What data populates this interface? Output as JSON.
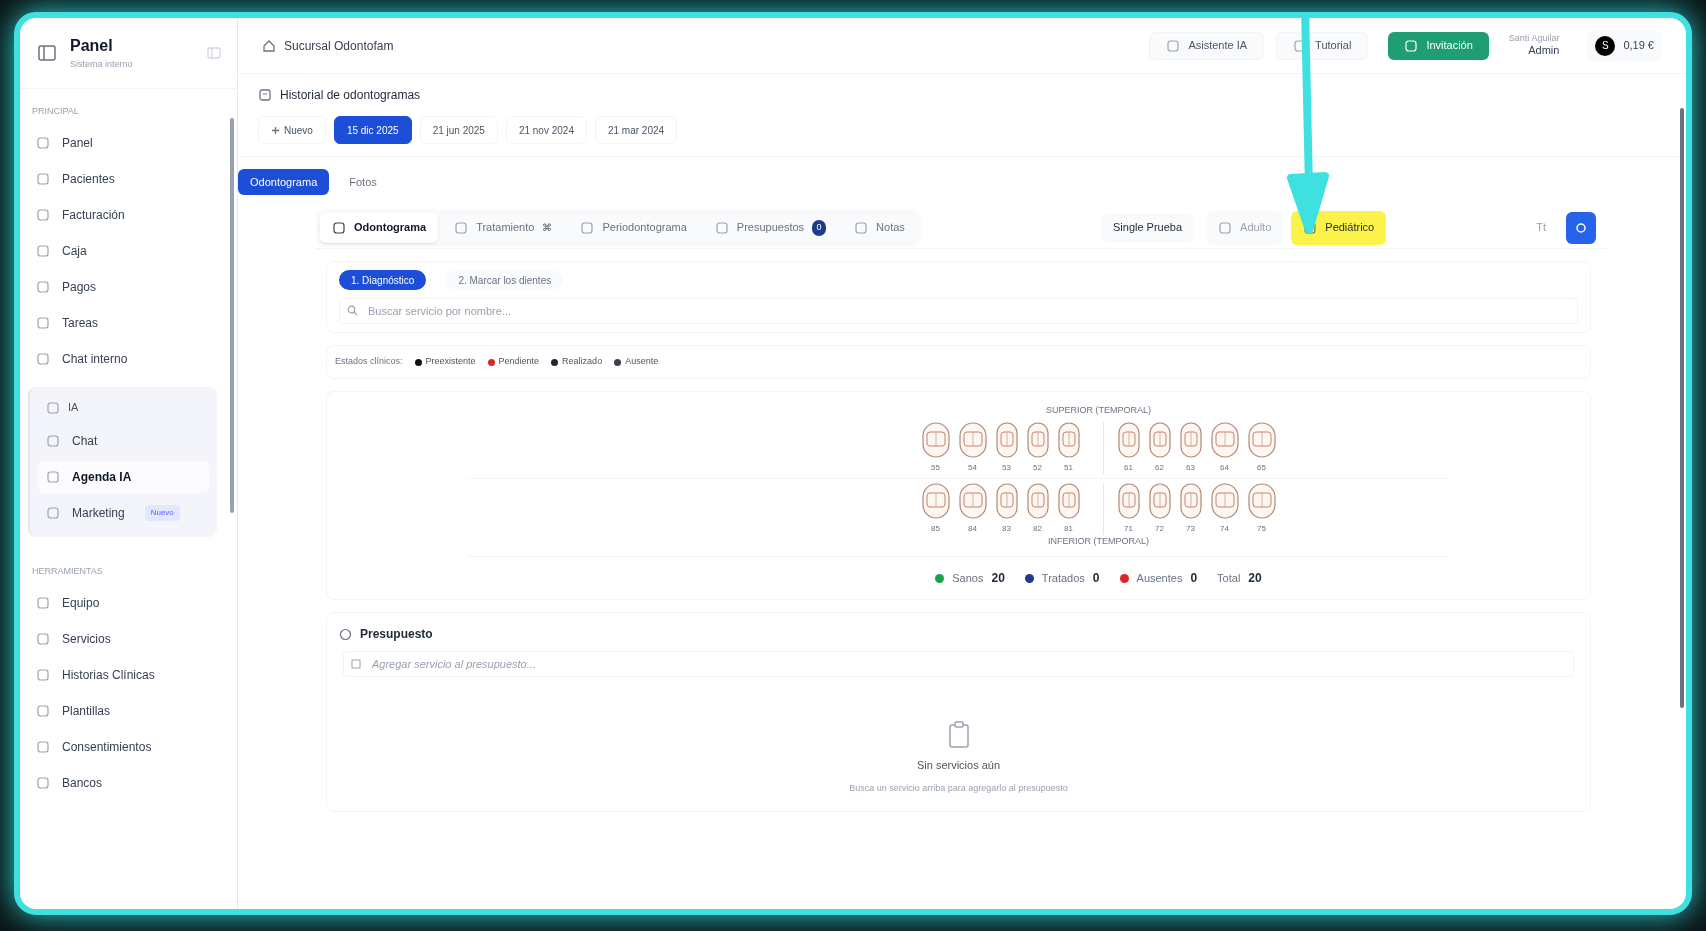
{
  "sidebar": {
    "title": "Panel",
    "subtitle": "Sistema interno",
    "sections": [
      {
        "kind": "plain",
        "label": "PRINCIPAL",
        "items": [
          {
            "label": "Panel",
            "selected": false
          },
          {
            "label": "Pacientes",
            "selected": false
          },
          {
            "label": "Facturación",
            "selected": false
          },
          {
            "label": "Caja",
            "selected": false
          },
          {
            "label": "Pagos",
            "selected": false
          },
          {
            "label": "Tareas",
            "selected": false
          },
          {
            "label": "Chat interno",
            "selected": false
          }
        ]
      },
      {
        "kind": "group",
        "label": "IA",
        "items": [
          {
            "label": "Chat",
            "selected": false
          },
          {
            "label": "Agenda IA",
            "selected": true
          },
          {
            "label": "Marketing",
            "selected": false,
            "badge": "Nuevo"
          }
        ]
      },
      {
        "kind": "plain",
        "label": "HERRAMIENTAS",
        "items": [
          {
            "label": "Equipo",
            "selected": false
          },
          {
            "label": "Servicios",
            "selected": false
          },
          {
            "label": "Historias Clínicas",
            "selected": false
          },
          {
            "label": "Plantillas",
            "selected": false
          },
          {
            "label": "Consentimientos",
            "selected": false
          },
          {
            "label": "Bancos",
            "selected": false
          }
        ]
      }
    ]
  },
  "topbar": {
    "branch": "Sucursal Odontofam",
    "buttons": [
      {
        "label": "Asistente IA",
        "kind": "outline"
      },
      {
        "label": "Tutorial",
        "kind": "outline"
      },
      {
        "label": "Invitación",
        "kind": "primary"
      }
    ],
    "user": {
      "name": "Santi Aguilar",
      "role": "Admin"
    },
    "balance": {
      "initial": "S",
      "amount": "0,19 €"
    }
  },
  "history": {
    "title": "Historial de odontogramas",
    "chips": [
      {
        "label": "Nuevo",
        "kind": "new",
        "selected": false
      },
      {
        "label": "15 dic 2025",
        "kind": "date",
        "selected": true
      },
      {
        "label": "21 jun 2025",
        "kind": "date",
        "selected": false
      },
      {
        "label": "21 nov 2024",
        "kind": "date",
        "selected": false
      },
      {
        "label": "21 mar 2024",
        "kind": "date",
        "selected": false
      }
    ]
  },
  "view_tabs": [
    {
      "label": "Odontograma",
      "selected": true
    },
    {
      "label": "Fotos",
      "selected": false
    }
  ],
  "sub_tabs": [
    {
      "label": "Odontograma",
      "selected": true
    },
    {
      "label": "Tratamiento",
      "selected": false,
      "shortcut": "⌘"
    },
    {
      "label": "Periodontograma",
      "selected": false
    },
    {
      "label": "Presupuestos",
      "selected": false,
      "badge": "0"
    },
    {
      "label": "Notas",
      "selected": false
    }
  ],
  "patient": "Single Prueba",
  "modes": [
    {
      "label": "Adulto",
      "selected": false,
      "highlighted": false
    },
    {
      "label": "Pediátrico",
      "selected": true,
      "highlighted": true
    }
  ],
  "font_toggle": "Tt",
  "steps": [
    {
      "label": "1. Diagnóstico",
      "selected": true
    },
    {
      "label": "2. Marcar los dientes",
      "selected": false
    }
  ],
  "search": {
    "placeholder": "Buscar servicio por nombre..."
  },
  "legend": {
    "label": "Estados clínicos:",
    "items": [
      {
        "label": "Preexistente",
        "color": "#111111"
      },
      {
        "label": "Pendiente",
        "color": "#dc2626"
      },
      {
        "label": "Realizado",
        "color": "#1f2937"
      },
      {
        "label": "Ausente",
        "color": "#374151"
      }
    ]
  },
  "odontogram": {
    "upper_label": "SUPERIOR (TEMPORAL)",
    "upper": [
      "55",
      "54",
      "53",
      "52",
      "51",
      "61",
      "62",
      "63",
      "64",
      "65"
    ],
    "lower": [
      "85",
      "84",
      "83",
      "82",
      "81",
      "71",
      "72",
      "73",
      "74",
      "75"
    ],
    "lower_label": "INFERIOR (TEMPORAL)"
  },
  "summary": [
    {
      "kind": "dot",
      "label": "Sanos",
      "value": "20",
      "color": "#16a34a"
    },
    {
      "kind": "dot",
      "label": "Tratados",
      "value": "0",
      "color": "#1e3a8a"
    },
    {
      "kind": "dot",
      "label": "Ausentes",
      "value": "0",
      "color": "#dc2626"
    },
    {
      "kind": "total",
      "label": "Total",
      "value": "20"
    }
  ],
  "budget": {
    "title": "Presupuesto",
    "placeholder": "Agregar servicio al presupuesto...",
    "empty_title": "Sin servicios aún",
    "empty_text": "Busca un servicio arriba para agregarlo al presupuesto"
  }
}
